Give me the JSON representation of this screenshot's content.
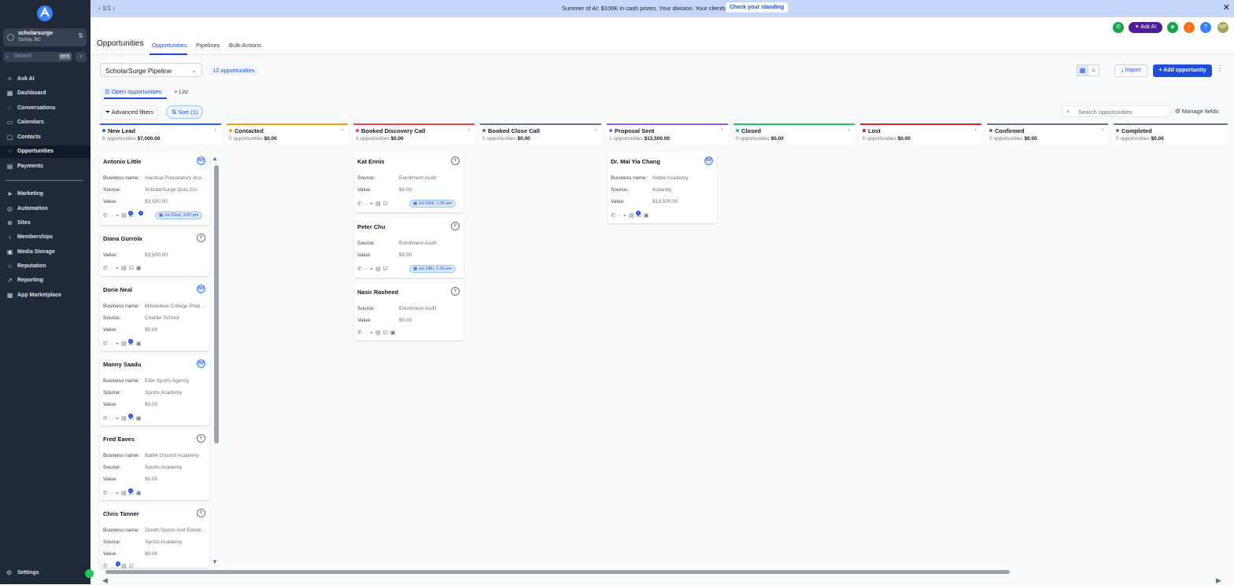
{
  "sidebar": {
    "account_name": "scholarsurge",
    "account_location": "Surrey, BC",
    "search_placeholder": "Search",
    "search_shortcut": "ctrl K",
    "items": [
      {
        "label": "Ask AI",
        "icon": "sparkle-icon"
      },
      {
        "label": "Dashboard",
        "icon": "grid-icon"
      },
      {
        "label": "Conversations",
        "icon": "chat-icon"
      },
      {
        "label": "Calendars",
        "icon": "calendar-icon"
      },
      {
        "label": "Contacts",
        "icon": "contact-icon"
      },
      {
        "label": "Opportunities",
        "icon": "opportunities-icon"
      },
      {
        "label": "Payments",
        "icon": "payments-icon"
      },
      {
        "label": "Marketing",
        "icon": "send-icon"
      },
      {
        "label": "Automation",
        "icon": "automation-icon"
      },
      {
        "label": "Sites",
        "icon": "globe-icon"
      },
      {
        "label": "Memberships",
        "icon": "membership-icon"
      },
      {
        "label": "Media Storage",
        "icon": "media-icon"
      },
      {
        "label": "Reputation",
        "icon": "star-icon"
      },
      {
        "label": "Reporting",
        "icon": "chart-icon"
      },
      {
        "label": "App Marketplace",
        "icon": "apps-icon"
      }
    ],
    "settings_label": "Settings"
  },
  "banner": {
    "pager": "1/1",
    "text": "Summer of AI: $100K in cash prizes. Your division. Your clients.",
    "button": "Check your standing"
  },
  "header": {
    "title": "Opportunities",
    "tabs": [
      "Opportunities",
      "Pipelines",
      "Bulk Actions"
    ],
    "ask_ai": "Ask AI",
    "user_initials": "NP"
  },
  "toolbar": {
    "pipeline": "ScholarSurge Pipeline",
    "count": "12 opportunities",
    "subtabs": [
      "Open opportunities",
      "List"
    ],
    "advanced_filters": "Advanced filters",
    "sort": "Sort (1)",
    "import": "Import",
    "add": "Add opportunity",
    "search_placeholder": "Search opportunities",
    "manage_fields": "Manage fields"
  },
  "columns": [
    {
      "name": "New Lead",
      "count": "8 opportunities",
      "sum": "$7,000.00",
      "color": "#2563eb"
    },
    {
      "name": "Contacted",
      "count": "0 opportunities",
      "sum": "$0.00",
      "color": "#f59e0b"
    },
    {
      "name": "Booked Discovery Call",
      "count": "3 opportunities",
      "sum": "$0.00",
      "color": "#ef4444"
    },
    {
      "name": "Booked Close Call",
      "count": "0 opportunities",
      "sum": "$0.00",
      "color": "#6b7280"
    },
    {
      "name": "Proposal Sent",
      "count": "1 opportunities",
      "sum": "$13,500.00",
      "color": "#8b5cf6"
    },
    {
      "name": "Closed",
      "count": "0 opportunities",
      "sum": "$0.00",
      "color": "#22c55e"
    },
    {
      "name": "Lost",
      "count": "0 opportunities",
      "sum": "$0.00",
      "color": "#dc2626"
    },
    {
      "name": "Confirmed",
      "count": "0 opportunities",
      "sum": "$0.00",
      "color": "#6b7280"
    },
    {
      "name": "Completed",
      "count": "0 opportunities",
      "sum": "$0.00",
      "color": "#6b7280"
    }
  ],
  "labels": {
    "business": "Business name:",
    "source": "Source:",
    "value": "Value:"
  },
  "cards": {
    "c1": {
      "name": "Antonio Little",
      "avatar": "BM",
      "business": "Alachua Preparatory Aca...",
      "source": "ScholarSurge Quiz /Go",
      "value": "$3,500.00",
      "date": "Jul 22nd, 3:00 pm",
      "badge1": "2",
      "badge2": "1"
    },
    "c2": {
      "name": "Diana Gurrola",
      "value": "$3,500.00"
    },
    "c3": {
      "name": "Dorie Neal",
      "avatar": "BM",
      "business": "Milwaukee College Prep ...",
      "source": "Charter School",
      "value": "$0.00",
      "badge1": "1"
    },
    "c4": {
      "name": "Manny Saadu",
      "avatar": "BM",
      "business": "Elite Sports Agency",
      "source": "Sports Academy",
      "value": "$0.00",
      "badge1": "1"
    },
    "c5": {
      "name": "Fred Eaves",
      "business": "Battle Ground Academy",
      "source": "Sports Academy",
      "value": "$0.00",
      "badge1": "1"
    },
    "c6": {
      "name": "Chris Tanner",
      "business": "Zenith Sports And Eventi...",
      "source": "Sports Academy",
      "value": "$0.00",
      "badge1": "1"
    },
    "d1": {
      "name": "Kat Ennis",
      "source": "Enrollment Audit",
      "value": "$0.00",
      "date": "Jul 23rd, 1:00 pm"
    },
    "d2": {
      "name": "Peter Chu",
      "source": "Enrollment Audit",
      "value": "$0.00",
      "date": "Jul 24th, 1:00 pm"
    },
    "d3": {
      "name": "Nasir Rasheed",
      "source": "Enrollment Audit",
      "value": "$0.00"
    },
    "p1": {
      "name": "Dr. Mai Yia Chang",
      "avatar": "BM",
      "business": "Noble Academy",
      "source": "Instantly",
      "value": "$13,500.00",
      "badge1": "1"
    }
  }
}
